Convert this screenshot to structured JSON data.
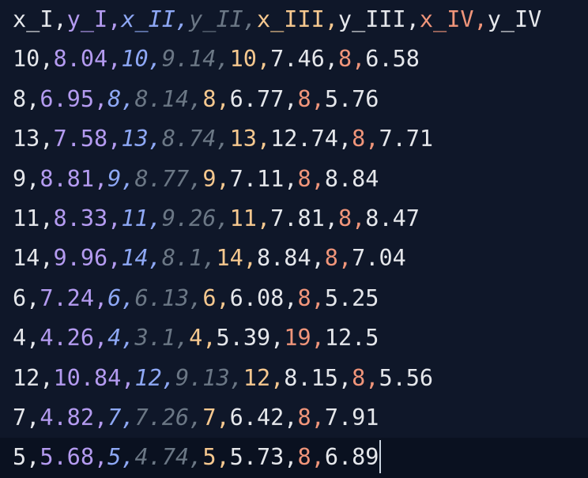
{
  "colors": {
    "background": "#0f1729",
    "col_1": "#e5e7eb",
    "col_2": "#b49bf0",
    "col_3": "#8ea8f5",
    "col_4": "#6b7785",
    "col_5": "#f6c88f",
    "col_6": "#e5e7eb",
    "col_7": "#f0957a",
    "col_8": "#e5e7eb"
  },
  "delimiter": ",",
  "header": [
    "x_I",
    "y_I",
    "x_II",
    "y_II",
    "x_III",
    "y_III",
    "x_IV",
    "y_IV"
  ],
  "rows": [
    [
      "10",
      "8.04",
      "10",
      "9.14",
      "10",
      "7.46",
      "8",
      "6.58"
    ],
    [
      "8",
      "6.95",
      "8",
      "8.14",
      "8",
      "6.77",
      "8",
      "5.76"
    ],
    [
      "13",
      "7.58",
      "13",
      "8.74",
      "13",
      "12.74",
      "8",
      "7.71"
    ],
    [
      "9",
      "8.81",
      "9",
      "8.77",
      "9",
      "7.11",
      "8",
      "8.84"
    ],
    [
      "11",
      "8.33",
      "11",
      "9.26",
      "11",
      "7.81",
      "8",
      "8.47"
    ],
    [
      "14",
      "9.96",
      "14",
      "8.1",
      "14",
      "8.84",
      "8",
      "7.04"
    ],
    [
      "6",
      "7.24",
      "6",
      "6.13",
      "6",
      "6.08",
      "8",
      "5.25"
    ],
    [
      "4",
      "4.26",
      "4",
      "3.1",
      "4",
      "5.39",
      "19",
      "12.5"
    ],
    [
      "12",
      "10.84",
      "12",
      "9.13",
      "12",
      "8.15",
      "8",
      "5.56"
    ],
    [
      "7",
      "4.82",
      "7",
      "7.26",
      "7",
      "6.42",
      "8",
      "7.91"
    ],
    [
      "5",
      "5.68",
      "5",
      "4.74",
      "5",
      "5.73",
      "8",
      "6.89"
    ]
  ]
}
